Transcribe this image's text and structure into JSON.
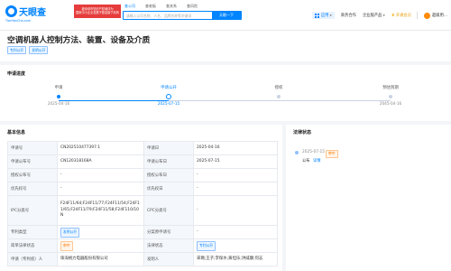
{
  "header": {
    "logo_name": "天眼查",
    "logo_sub": "TianYanCha.com",
    "promo_text": "国家中小企业发展子基金旗下机构",
    "promo_text_top": "被深圳市知识产权局评为",
    "search_tabs": [
      "查公司",
      "查老板",
      "查关系",
      "查风险"
    ],
    "search_placeholder": "请输入公司名称、人名、品牌名称等关键词",
    "search_button": "天眼一下",
    "nav": {
      "app": "应用",
      "business": "商务合作",
      "enterprise": "企业版产品",
      "vip": "开通会员",
      "user": "超级用..."
    }
  },
  "patent": {
    "title": "空调机器人控制方法、装置、设备及介质",
    "tags": [
      "专利公开",
      "发明公开"
    ]
  },
  "progress": {
    "section_title": "申请进度",
    "steps": [
      {
        "label": "申请",
        "date": "2025-04-16",
        "state": "done"
      },
      {
        "label": "申请公开",
        "date": "2025-07-15",
        "state": "current"
      },
      {
        "label": "授权",
        "date": "",
        "state": "pending"
      },
      {
        "label": "预估到期",
        "date": "2045-04-16",
        "state": "pending"
      }
    ]
  },
  "basic_info": {
    "section_title": "基本信息",
    "rows": [
      {
        "k1": "申请号",
        "v1": "CN202510477397.1",
        "k2": "申请日",
        "v2": "2025-04-16"
      },
      {
        "k1": "申请公布号",
        "v1": "CN120318168A",
        "k2": "申请公布日",
        "v2": "2025-07-15"
      },
      {
        "k1": "授权公布号",
        "v1": "-",
        "k2": "授权公布日",
        "v2": "-"
      },
      {
        "k1": "优先权号",
        "v1": "-",
        "k2": "优先权日",
        "v2": "-"
      },
      {
        "k1": "IPC分类号",
        "v1": "F24F11/64;F24F11/77;F24F11/54;F24F11/65;F24F11/79;F24F11/58;F24F110/10N",
        "k2": "CPC分类号",
        "v2": "-"
      },
      {
        "k1": "专利类型",
        "v1": "发明公开",
        "k2": "分案原申请号",
        "v2": "-"
      },
      {
        "k1": "简单法律状态",
        "v1": "审中",
        "k2": "法律状态",
        "v2": "专利公开"
      },
      {
        "k1": "申请（专利权）人",
        "v1": "珠海格力电器股份有限公司",
        "k2": "发明人",
        "v2": "宋璐;王子;李保水;黄坦乐;洪威康;何志"
      }
    ]
  },
  "legal_status": {
    "section_title": "法律状态",
    "date": "2025-07-15",
    "chip": "审中",
    "event": "公布",
    "detail_link": "详情"
  },
  "colors": {
    "accent": "#0084ff",
    "promo_red": "#e63c3c",
    "pending_orange": "#ff7a00"
  }
}
